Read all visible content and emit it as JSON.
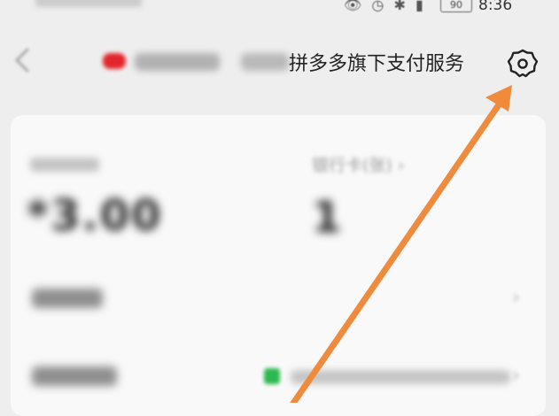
{
  "status_bar": {
    "icons": "👁 ◷ ✱ ▮",
    "battery": "90",
    "time": "8:36"
  },
  "header": {
    "title": "拼多多旗下支付服务",
    "back_icon": "chevron-left-icon",
    "settings_icon": "gear-icon"
  },
  "card": {
    "bank_card_label": "银行卡(张) ›",
    "amount": "*3.00",
    "card_count": "1",
    "chevron": "›"
  },
  "annotation": {
    "arrow_color": "#f08a3c"
  }
}
